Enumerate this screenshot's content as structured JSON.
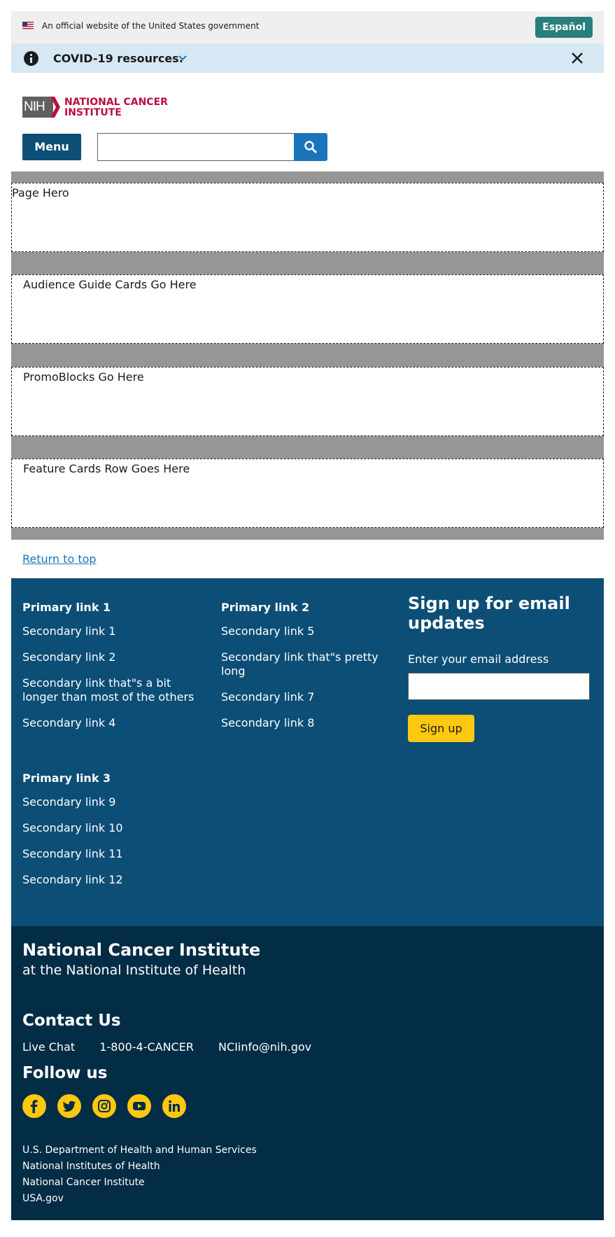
{
  "gov_banner": {
    "text": "An official website of the United States government",
    "language_button": "Español"
  },
  "alert": {
    "text": "COVID-19 resources."
  },
  "header": {
    "logo_nih": "NIH",
    "logo_line1": "NATIONAL CANCER",
    "logo_line2": "INSTITUTE",
    "menu_label": "Menu",
    "search_value": ""
  },
  "main": {
    "blocks": [
      "Page Hero",
      "Audience Guide Cards Go Here",
      "PromoBlocks Go Here",
      "Feature Cards Row Goes Here"
    ],
    "return_to_top": "Return to top"
  },
  "footer": {
    "columns": [
      {
        "primary": "Primary link 1",
        "secondary": [
          "Secondary link 1",
          "Secondary link 2",
          "Secondary link that\"s a bit longer than most of the others",
          "Secondary link 4"
        ]
      },
      {
        "primary": "Primary link 2",
        "secondary": [
          "Secondary link 5",
          "Secondary link that\"s pretty long",
          "Secondary link 7",
          "Secondary link 8"
        ]
      },
      {
        "primary": "Primary link 3",
        "secondary": [
          "Secondary link 9",
          "Secondary link 10",
          "Secondary link 11",
          "Secondary link 12"
        ]
      }
    ],
    "signup": {
      "title": "Sign up for email updates",
      "label": "Enter your email address",
      "input_value": "",
      "button": "Sign up"
    },
    "org": {
      "name": "National Cancer Institute",
      "sub": "at the National Institute of Health"
    },
    "contact": {
      "heading": "Contact Us",
      "live_chat": "Live Chat",
      "phone": "1-800-4-CANCER",
      "email": "NCIinfo@nih.gov"
    },
    "follow": {
      "heading": "Follow us",
      "icons": [
        "facebook-icon",
        "twitter-icon",
        "instagram-icon",
        "youtube-icon",
        "linkedin-icon"
      ]
    },
    "agency_links": [
      "U.S. Department of Health and Human Services",
      "National Institutes of Health",
      "National Cancer Institute",
      "USA.gov"
    ]
  },
  "colors": {
    "brand_red": "#bb0e3d",
    "primary_blue": "#0c4e76",
    "dark_blue": "#032c45",
    "accent_yellow": "#fdc80f",
    "teal": "#2a7e7e",
    "link_blue": "#1a74b8"
  }
}
